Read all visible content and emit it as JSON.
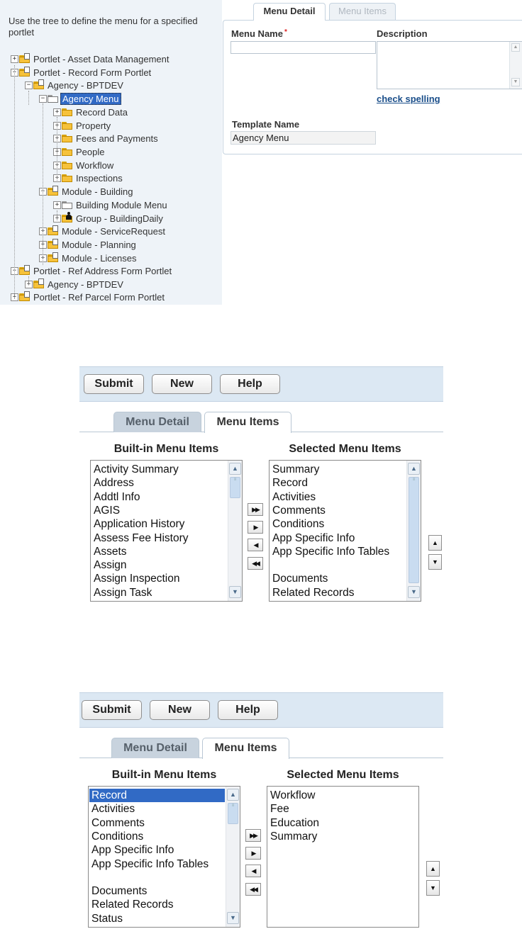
{
  "tree_panel": {
    "instruction": "Use the tree to define the menu for a specified portlet",
    "nodes": [
      {
        "label": "Portlet - Asset Data Management",
        "exp": "+"
      },
      {
        "label": "Portlet - Record Form Portlet",
        "exp": "−"
      },
      {
        "label": "Agency - BPTDEV",
        "exp": "−"
      },
      {
        "label": "Agency Menu",
        "exp": "−"
      },
      {
        "label": "Record Data",
        "exp": "+"
      },
      {
        "label": "Property",
        "exp": "+"
      },
      {
        "label": "Fees and Payments",
        "exp": "+"
      },
      {
        "label": "People",
        "exp": "+"
      },
      {
        "label": "Workflow",
        "exp": "+"
      },
      {
        "label": "Inspections",
        "exp": "+"
      },
      {
        "label": "Module - Building",
        "exp": "−"
      },
      {
        "label": "Building Module Menu",
        "exp": "+"
      },
      {
        "label": "Group - BuildingDaily",
        "exp": "+"
      },
      {
        "label": "Module - ServiceRequest",
        "exp": "+"
      },
      {
        "label": "Module - Planning",
        "exp": "+"
      },
      {
        "label": "Module - Licenses",
        "exp": "+"
      },
      {
        "label": "Portlet - Ref Address Form Portlet",
        "exp": "−"
      },
      {
        "label": "Agency - BPTDEV",
        "exp": "+"
      },
      {
        "label": "Portlet - Ref Parcel Form Portlet",
        "exp": "+"
      }
    ]
  },
  "detail_panel": {
    "tabs": [
      "Menu Detail",
      "Menu Items"
    ],
    "menu_name_label": "Menu Name",
    "required_mark": "*",
    "description_label": "Description",
    "check_spelling": "check spelling",
    "template_name_label": "Template Name",
    "template_name_value": "Agency Menu"
  },
  "screen2": {
    "buttons": [
      "Submit",
      "New",
      "Help"
    ],
    "tabs": [
      "Menu Detail",
      "Menu Items"
    ],
    "builtin_title": "Built-in Menu Items",
    "selected_title": "Selected Menu Items",
    "builtin_items": [
      "Activity Summary",
      "Address",
      "Addtl Info",
      "AGIS",
      "Application History",
      "Assess Fee History",
      "Assets",
      "Assign",
      "Assign Inspection",
      "Assign Task"
    ],
    "selected_items": [
      "Summary",
      "Record",
      "Activities",
      "Comments",
      "Conditions",
      "App Specific Info",
      "App Specific Info Tables",
      "",
      "Documents",
      "Related Records"
    ]
  },
  "screen3": {
    "buttons": [
      "Submit",
      "New",
      "Help"
    ],
    "tabs": [
      "Menu Detail",
      "Menu Items"
    ],
    "builtin_title": "Built-in Menu Items",
    "selected_title": "Selected Menu Items",
    "builtin_items": [
      "Record",
      "Activities",
      "Comments",
      "Conditions",
      "App Specific Info",
      "App Specific Info Tables",
      "",
      "Documents",
      "Related Records",
      "Status"
    ],
    "builtin_selected": "Record",
    "selected_items": [
      "Workflow",
      "Fee",
      "Education",
      "Summary"
    ]
  },
  "move_buttons": {
    "add_all": "▶▶",
    "add": "▶",
    "remove": "◀",
    "remove_all": "◀◀"
  },
  "order_buttons": {
    "up": "▲",
    "down": "▼"
  },
  "colors": {
    "selection": "#316ac5",
    "toolbar": "#dce8f3",
    "tree_bg": "#eef3f8",
    "link": "#1a4e8a"
  }
}
